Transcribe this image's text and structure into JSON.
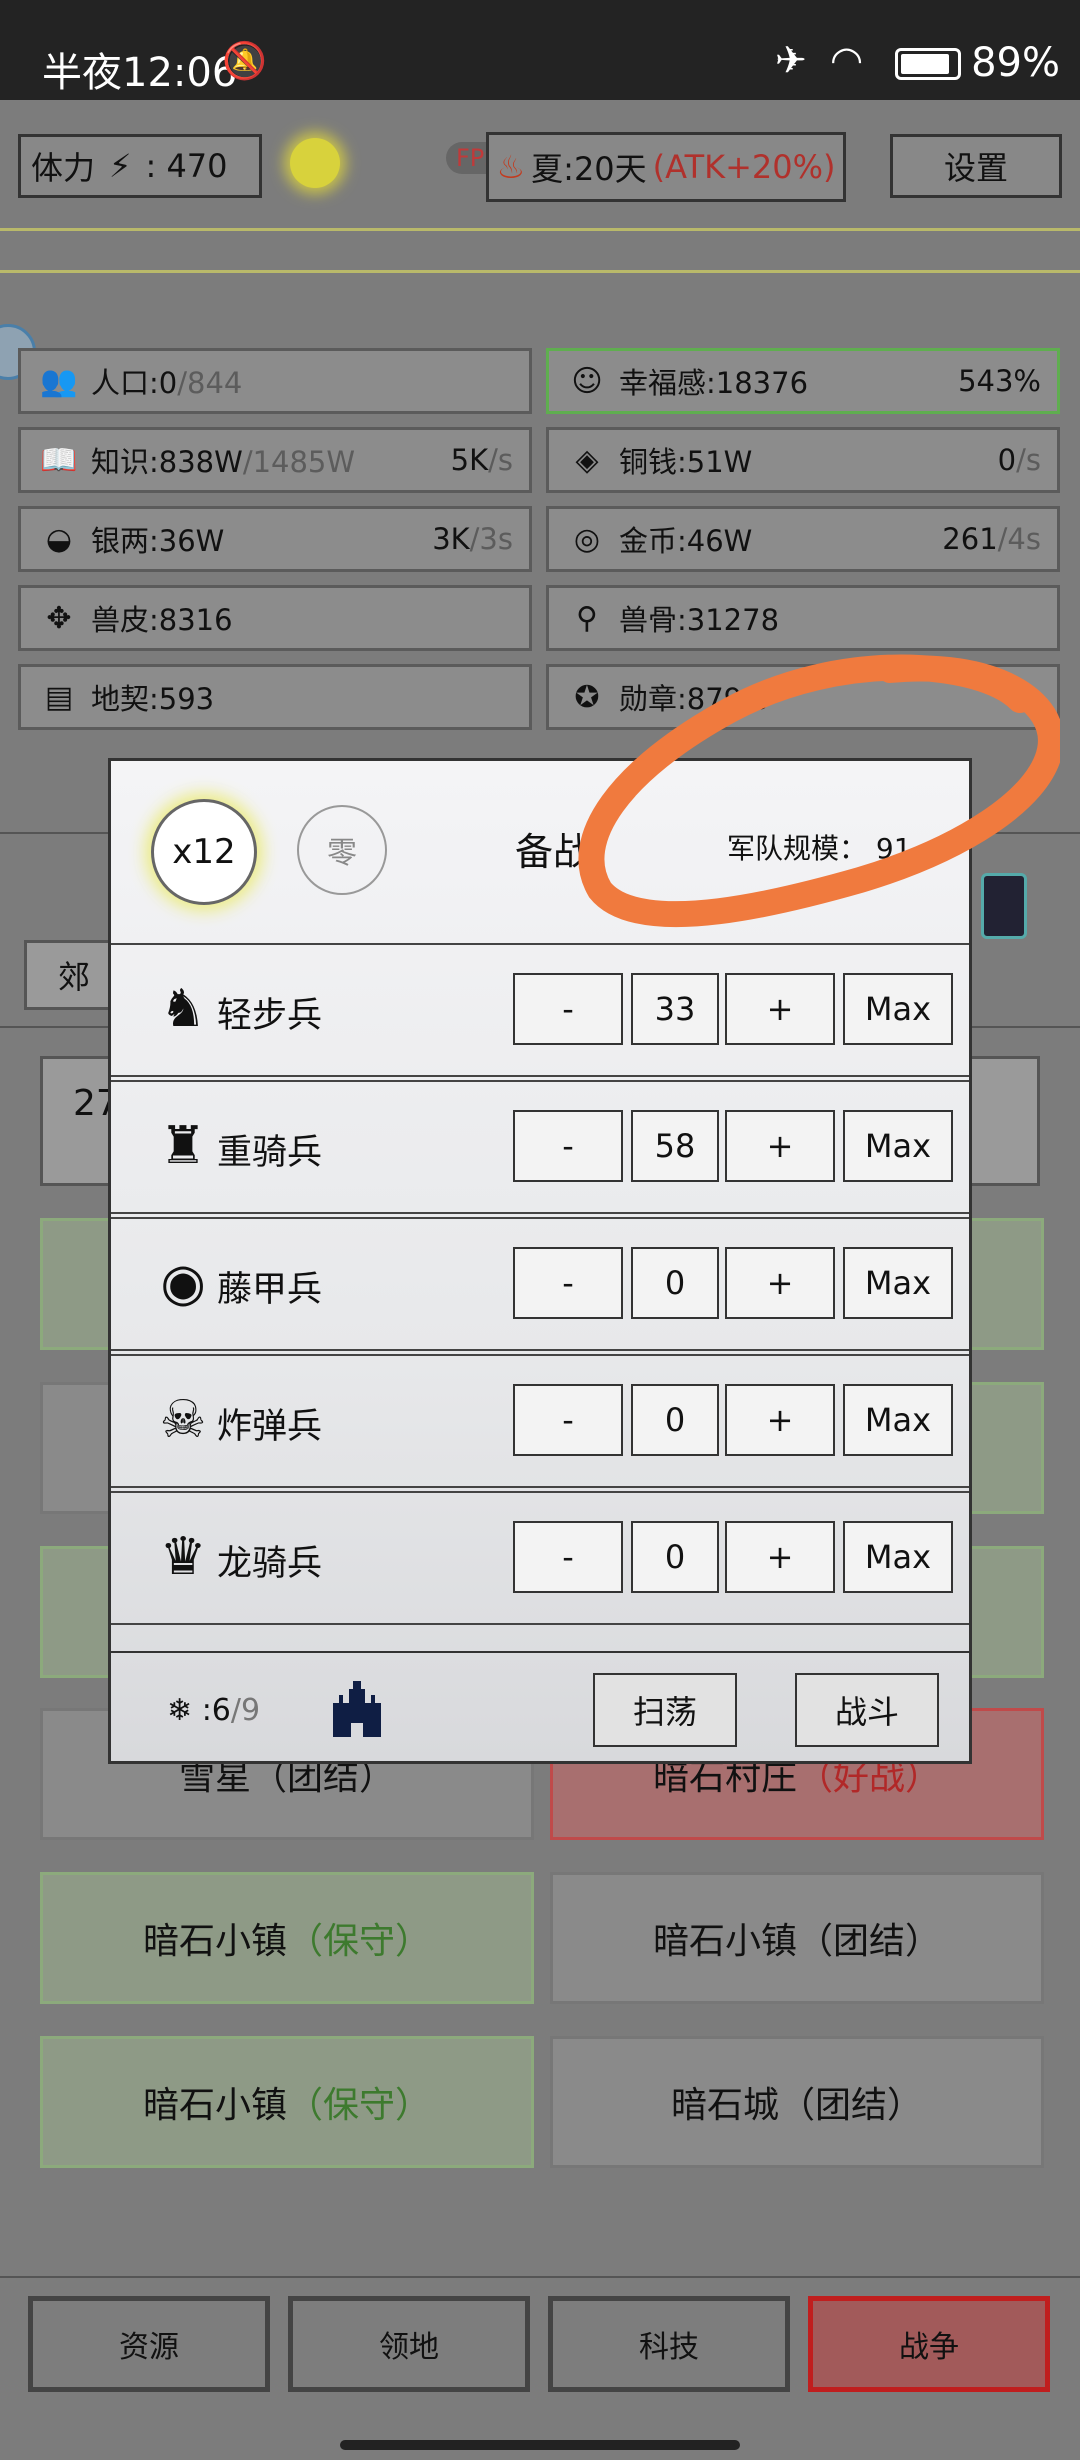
{
  "status_bar": {
    "time": "半夜12:06",
    "battery": "89%"
  },
  "top": {
    "stamina_label": "体力",
    "stamina_value": "470",
    "season": "夏:20天",
    "season_bonus": "(ATK+20%)",
    "fps_badge": "FPS3",
    "settings": "设置"
  },
  "resources": [
    {
      "icon": "people-icon",
      "name": "人口:0",
      "extra": "/844",
      "rate": "",
      "rate_unit": ""
    },
    {
      "icon": "smile-icon",
      "name": "幸福感:18376",
      "extra": "",
      "rate": "543%",
      "rate_unit": ""
    },
    {
      "icon": "book-icon",
      "name": "知识:838W",
      "extra": "/1485W",
      "rate": "5K",
      "rate_unit": "/s"
    },
    {
      "icon": "coin-icon",
      "name": "铜钱:51W",
      "extra": "",
      "rate": "0",
      "rate_unit": "/s"
    },
    {
      "icon": "ingot-icon",
      "name": "银两:36W",
      "extra": "",
      "rate": "3K",
      "rate_unit": "/3s"
    },
    {
      "icon": "gold-icon",
      "name": "金币:46W",
      "extra": "",
      "rate": "261",
      "rate_unit": "/4s"
    },
    {
      "icon": "pelt-icon",
      "name": "兽皮:8316",
      "extra": "",
      "rate": "",
      "rate_unit": ""
    },
    {
      "icon": "bone-icon",
      "name": "兽骨:31278",
      "extra": "",
      "rate": "",
      "rate_unit": ""
    },
    {
      "icon": "deed-icon",
      "name": "地契:593",
      "extra": "",
      "rate": "",
      "rate_unit": ""
    },
    {
      "icon": "medal-icon",
      "name": "勋章:879.0",
      "extra": "",
      "rate": "",
      "rate_unit": ""
    }
  ],
  "bg_partial": {
    "tab": "郊",
    "count": "27"
  },
  "bg_targets": [
    {
      "name": "雪星",
      "tag": "（团结）",
      "style": "gray"
    },
    {
      "name": "暗石村庄",
      "tag": "（好战）",
      "style": "red"
    },
    {
      "name": "暗石小镇",
      "tag": "（保守）",
      "style": "green"
    },
    {
      "name": "暗石小镇",
      "tag": "（团结）",
      "style": "gray"
    },
    {
      "name": "暗石小镇",
      "tag": "（保守）",
      "style": "green"
    },
    {
      "name": "暗石城",
      "tag": "（团结）",
      "style": "gray"
    }
  ],
  "bottom_nav": [
    "资源",
    "领地",
    "科技",
    "战争"
  ],
  "dialog": {
    "multiplier": "x12",
    "zero_btn": "零",
    "title": "备战",
    "army_label": "军队规模：",
    "army_value": "91",
    "units": [
      {
        "icon": "helmet-icon",
        "name": "轻步兵",
        "count": "33"
      },
      {
        "icon": "spartan-helmet-icon",
        "name": "重骑兵",
        "count": "58"
      },
      {
        "icon": "shield-icon",
        "name": "藤甲兵",
        "count": "0"
      },
      {
        "icon": "bomb-icon",
        "name": "炸弹兵",
        "count": "0"
      },
      {
        "icon": "knight-helmet-icon",
        "name": "龙骑兵",
        "count": "0"
      }
    ],
    "minus": "-",
    "plus": "+",
    "max": "Max",
    "snow_count": ":6",
    "snow_total": "/9",
    "sweep": "扫荡",
    "fight": "战斗"
  }
}
